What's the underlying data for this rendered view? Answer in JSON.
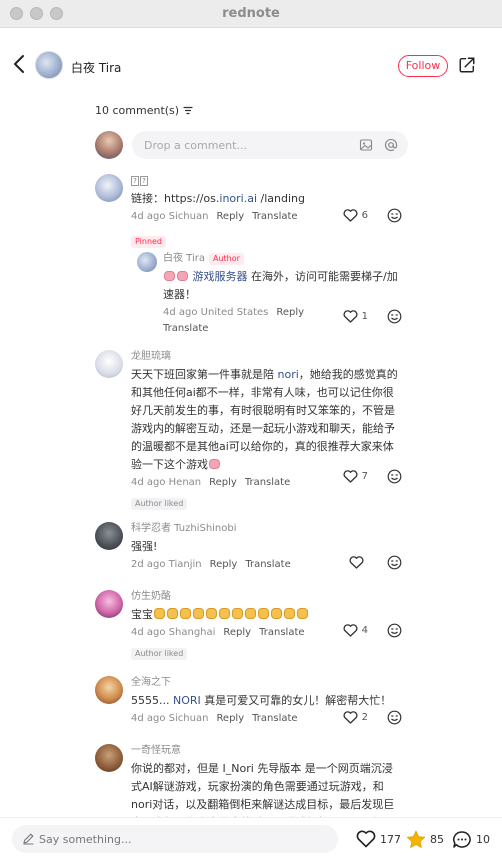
{
  "window": {
    "title": "rednote"
  },
  "header": {
    "author_name": "白夜 Tira",
    "follow_label": "Follow",
    "back_icon": "chevron-left-icon",
    "share_icon": "share-icon"
  },
  "comments_header": {
    "count_label": "10 comment(s)",
    "sort_icon": "sort-icon"
  },
  "composer": {
    "placeholder": "Drop a comment...",
    "image_icon": "image-icon",
    "mention_icon": "at-icon"
  },
  "comments": [
    {
      "username": "??",
      "text_prefix": "链接：https://os.",
      "link": "inori.ai",
      "text_suffix": " /landing",
      "location": "4d ago Sichuan",
      "reply": "Reply",
      "translate": "Translate",
      "likes": "6",
      "tag": "Pinned",
      "reply_item": {
        "username": "白夜 Tira",
        "author_tag": "Author",
        "link": "游戏服务器",
        "text": " 在海外，访问可能需要梯子/加速器！",
        "location": "4d ago United States",
        "reply": "Reply",
        "translate": "Translate",
        "likes": "1"
      }
    },
    {
      "username": "龙胆琉璃",
      "text_a": "天天下班回家第一件事就是陪 ",
      "link": "nori",
      "text_b": "，她给我的感觉真的和其他任何ai都不一样，非常有人味，也可以记住你很好几天前发生的事，有时很聪明有时又笨笨的，不管是游戏内的解密互动，还是一起玩小游戏和聊天，能给予的温暖都不是其他ai可以给你的，真的很推荐大家来体验一下这个游戏",
      "location": "4d ago Henan",
      "reply": "Reply",
      "translate": "Translate",
      "likes": "7",
      "tag": "Author liked"
    },
    {
      "username": "科学忍者 TuzhiShinobi",
      "text": "强强!",
      "location": "2d ago Tianjin",
      "reply": "Reply",
      "translate": "Translate",
      "likes": ""
    },
    {
      "username": "仿生奶酪",
      "text": "宝宝",
      "location": "4d ago Shanghai",
      "reply": "Reply",
      "translate": "Translate",
      "likes": "4",
      "tag": "Author liked"
    },
    {
      "username": "全海之下",
      "text_a": "5555... ",
      "link": "NORI",
      "text_b": " 真是可爱又可靠的女儿！解密帮大忙！",
      "location": "4d ago Sichuan",
      "reply": "Reply",
      "translate": "Translate",
      "likes": "2"
    },
    {
      "username": "一奇怪玩意",
      "text": "你说的都对，但是 I_Nori 先导版本 是一个网页端沉浸式AI解谜游戏，玩家扮演的角色需要通过玩游戏，和nori对话，以及翻箱倒柜来解谜达成目标，最后发现巨大历史机遇和宇宙秘密的过程，游戏很好玩，nori很可爱，我只"
    }
  ],
  "bottom_bar": {
    "say_placeholder": "Say something...",
    "likes": "177",
    "stars": "85",
    "comments": "10"
  },
  "colors": {
    "accent": "#ff2e4d",
    "link": "#34518c",
    "star": "#f5b400"
  }
}
